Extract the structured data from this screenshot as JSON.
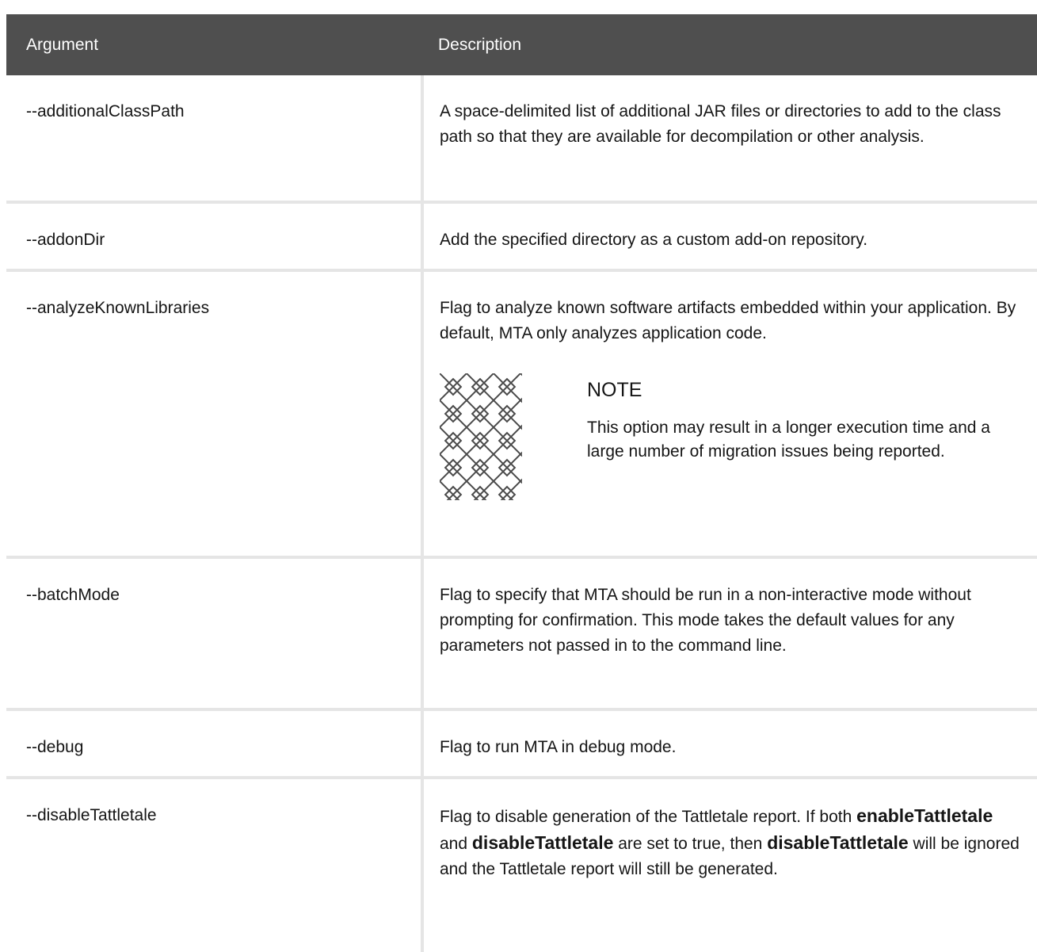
{
  "table": {
    "headers": {
      "argument": "Argument",
      "description": "Description"
    },
    "rows": [
      {
        "argument": "--additionalClassPath",
        "description": "A space-delimited list of additional JAR files or directories to add to the class path so that they are available for decompilation or other analysis."
      },
      {
        "argument": "--addonDir",
        "description": "Add the specified directory as a custom add-on repository."
      },
      {
        "argument": "--analyzeKnownLibraries",
        "description": "Flag to analyze known software artifacts embedded within your application. By default, MTA only analyzes application code.",
        "note": {
          "icon": "note-pattern-icon",
          "title": "NOTE",
          "text": "This option may result in a longer execution time and a large number of migration issues being reported."
        }
      },
      {
        "argument": "--batchMode",
        "description": "Flag to specify that MTA should be run in a non-interactive mode without prompting for confirmation. This mode takes the default values for any parameters not passed in to the command line."
      },
      {
        "argument": "--debug",
        "description": "Flag to run MTA in debug mode."
      },
      {
        "argument": "--disableTattletale",
        "description_parts": {
          "p1": "Flag to disable generation of the Tattletale report. If both ",
          "b1": "enableTattletale",
          "p2": " and ",
          "b2": "disableTattletale",
          "p3": " are set to true, then ",
          "b3": "disableTattletale",
          "p4": " will be ignored and the Tattletale report will still be generated."
        }
      }
    ]
  },
  "colors": {
    "header_bg": "#4f4f4f",
    "header_text": "#ffffff",
    "border": "#e5e5e5",
    "text": "#151515"
  }
}
